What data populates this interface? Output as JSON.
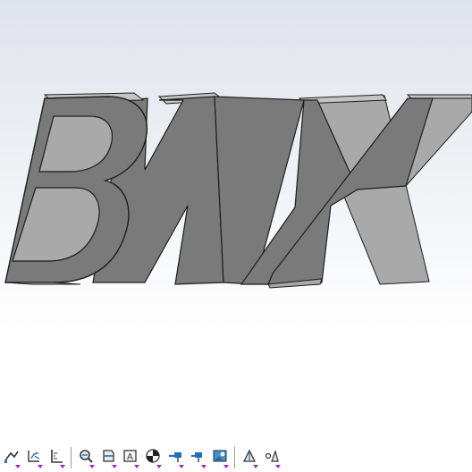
{
  "model": {
    "text": "BMX",
    "front_color": "#7a7a7a",
    "side_color": "#a9a9a9",
    "top_color": "#c4c4c4",
    "edge_color": "#1e1e1e"
  },
  "toolbar": {
    "buttons": [
      {
        "name": "edge-filter-icon"
      },
      {
        "name": "sketch-filter-icon"
      },
      {
        "name": "measure-icon"
      },
      {
        "name": "sep"
      },
      {
        "name": "zoom-to-fit-icon"
      },
      {
        "name": "section-view-icon"
      },
      {
        "name": "annotation-view-icon"
      },
      {
        "name": "display-style-icon"
      },
      {
        "name": "hide-show-items-icon"
      },
      {
        "name": "edit-appearance-icon"
      },
      {
        "name": "apply-scene-icon"
      },
      {
        "name": "sep"
      },
      {
        "name": "view-settings-icon"
      },
      {
        "name": "lighting-icon"
      }
    ]
  }
}
